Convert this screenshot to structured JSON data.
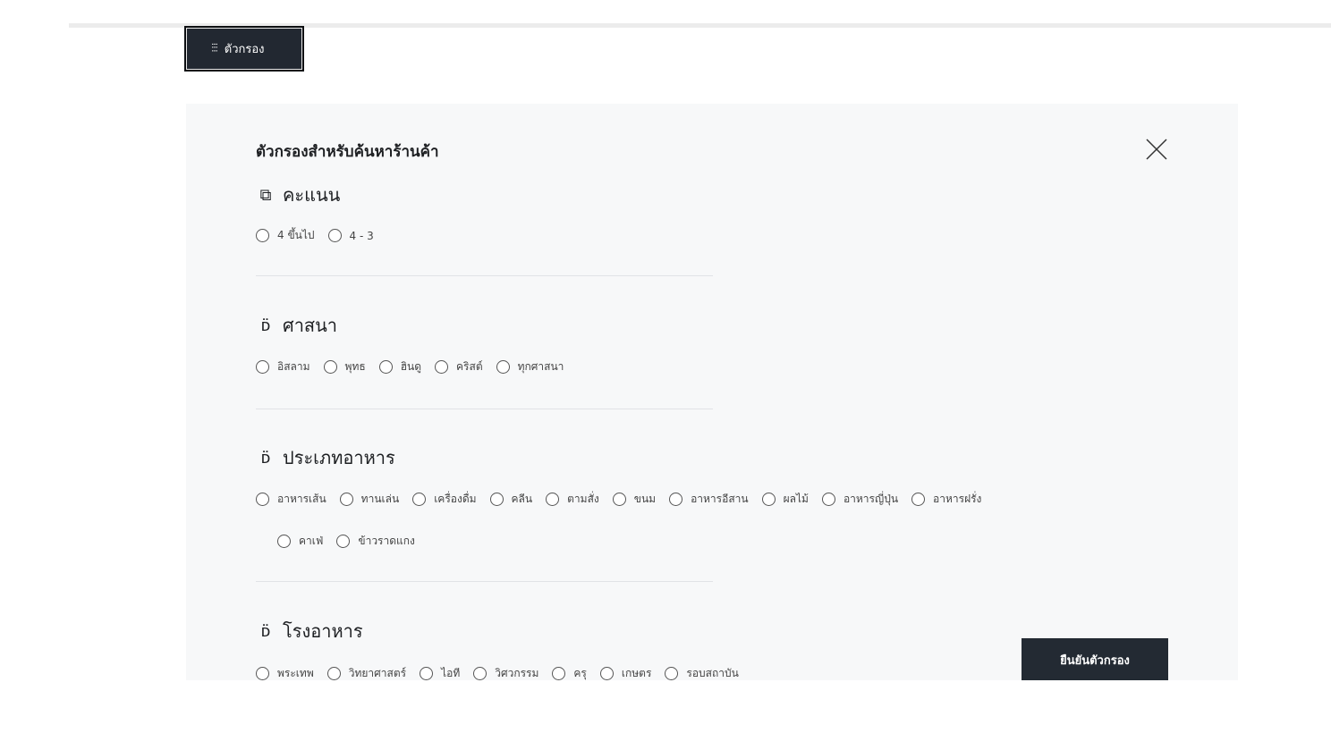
{
  "toolbar": {
    "filter_label": "ตัวกรอง",
    "filter_icon": "sliders-icon"
  },
  "panel": {
    "title": "ตัวกรองสำหรับค้นหาร้านค้า",
    "confirm_label": "ยืนยันตัวกรอง"
  },
  "sections": {
    "rating": {
      "icon": "Ꮚ",
      "title": "คะแนน",
      "options": [
        "4 ขึ้นไป",
        "4 - 3"
      ]
    },
    "religion": {
      "icon": "Ƃ:",
      "title": "ศาสนา",
      "options": [
        "อิสลาม",
        "พุทธ",
        "ฮินดู",
        "คริสต์",
        "ทุกศาสนา"
      ]
    },
    "food_type": {
      "icon": "Ƃ:",
      "title": "ประเภทอาหาร",
      "options": [
        "อาหารเส้น",
        "ทานเล่น",
        "เครื่องดื่ม",
        "คลีน",
        "ตามสั่ง",
        "ขนม",
        "อาหารอีสาน",
        "ผลไม้",
        "อาหารญี่ปุ่น",
        "อาหารฝรั่ง"
      ],
      "options_row2": [
        "คาเฟ่",
        "ข้าวราดแกง"
      ]
    },
    "canteen": {
      "icon": "Ƃ:",
      "title": "โรงอาหาร",
      "options": [
        "พระเทพ",
        "วิทยาศาสตร์",
        "ไอที",
        "วิศวกรรม",
        "ครุ",
        "เกษตร",
        "รอบสถาบัน"
      ]
    }
  }
}
